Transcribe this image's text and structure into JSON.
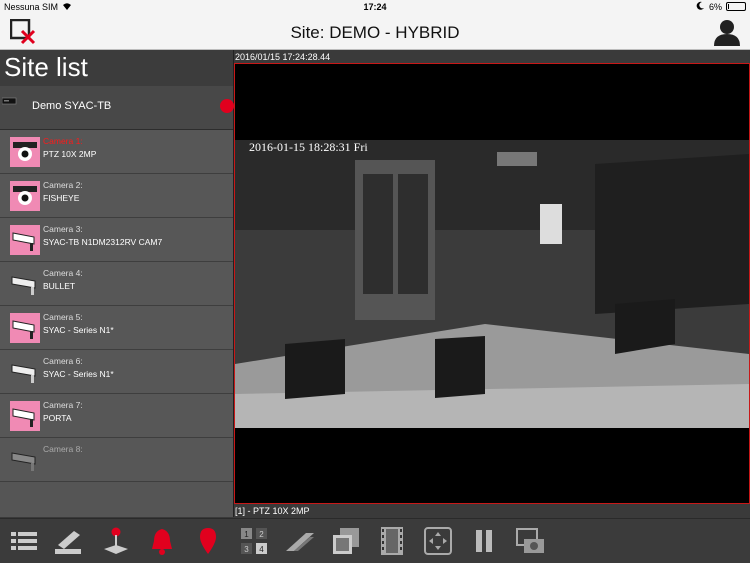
{
  "status_bar": {
    "carrier": "Nessuna SIM",
    "time": "17:24",
    "battery": "6%",
    "battery_level": 0.06
  },
  "header": {
    "title": "Site: DEMO - HYBRID"
  },
  "sidebar": {
    "title": "Site list",
    "site": {
      "name": "Demo SYAC-TB"
    },
    "cameras": [
      {
        "label": "Camera 1:",
        "model": "PTZ 10X 2MP",
        "icon": "ptz-dome-camera-icon"
      },
      {
        "label": "Camera 2:",
        "model": "FISHEYE",
        "icon": "ptz-dome-camera-icon"
      },
      {
        "label": "Camera 3:",
        "model": "SYAC-TB N1DM2312RV CAM7",
        "icon": "bullet-camera-icon"
      },
      {
        "label": "Camera 4:",
        "model": "BULLET",
        "icon": "bullet-camera-icon"
      },
      {
        "label": "Camera 5:",
        "model": "SYAC - Series N1*",
        "icon": "bullet-camera-icon"
      },
      {
        "label": "Camera 6:",
        "model": "SYAC - Series N1*",
        "icon": "bullet-camera-icon"
      },
      {
        "label": "Camera 7:",
        "model": "PORTA",
        "icon": "bullet-camera-icon"
      },
      {
        "label": "Camera 8:",
        "model": "",
        "icon": "bullet-camera-icon"
      }
    ]
  },
  "video": {
    "timestamp": "2016/01/15 17:24:28.44",
    "osd_text": "2016-01-15 18:28:31 Fri",
    "caption": "[1] - PTZ 10X 2MP"
  },
  "toolbar": {
    "buttons": [
      "list-icon",
      "keyboard-icon",
      "joystick-icon",
      "alarm-bell-icon",
      "location-pin-icon",
      "quad-layout-icon",
      "sequence-icon",
      "multi-view-icon",
      "film-icon",
      "ptz-directions-icon",
      "pause-icon",
      "snapshot-icon"
    ],
    "grid_numbers": [
      "1",
      "2",
      "3",
      "4"
    ]
  },
  "colors": {
    "accent_red": "#e1001e",
    "panel": "#555555",
    "toolbar": "#3b3b3b"
  }
}
